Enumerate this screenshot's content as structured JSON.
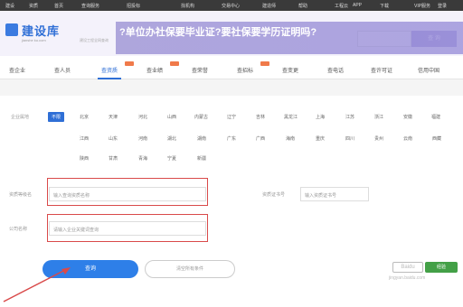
{
  "topbar": {
    "items": [
      "建设",
      "资质",
      "首页",
      "查询服务",
      "招投标",
      "找机构",
      "交易中心",
      "建造师",
      "帮助",
      "工程云",
      "APP",
      "下载",
      "VIP服务",
      "登录"
    ]
  },
  "header": {
    "logo_text": "建设库",
    "logo_sub": "jianshe ku.com",
    "note": "建设工程全网查询",
    "overlay_title": "?单位办社保要毕业证?要社保要学历证明吗?",
    "search_button": "查 询"
  },
  "nav": {
    "items": [
      "查企业",
      "查人员",
      "查资质",
      "查业绩",
      "查荣誉",
      "查招标",
      "查变更",
      "查电话",
      "查许可证",
      "信用中国"
    ],
    "active_index": 2
  },
  "filter": {
    "region_label": "企业属地",
    "provinces_row1": [
      "不限",
      "北京",
      "天津",
      "河北",
      "山西",
      "内蒙古",
      "辽宁",
      "吉林",
      "黑龙江",
      "上海",
      "江苏",
      "浙江",
      "安徽",
      "福建"
    ],
    "provinces_row2": [
      "江西",
      "山东",
      "河南",
      "湖北",
      "湖南",
      "广东",
      "广西",
      "海南",
      "重庆",
      "四川",
      "贵州",
      "云南",
      "西藏"
    ],
    "provinces_row3": [
      "陕西",
      "甘肃",
      "青海",
      "宁夏",
      "新疆"
    ],
    "name_label": "资质等级名",
    "name_placeholder": "输入查询资质名称",
    "cert_label": "资质证书号",
    "cert_placeholder": "输入资质证书号",
    "company_label": "公司名称",
    "company_placeholder": "请输入企业关键词查询"
  },
  "actions": {
    "search_label": "查询",
    "clear_label": "清空所有条件"
  },
  "watermark": {
    "badge": "Baidu",
    "green": "经验",
    "url": "jingyan.baidu.com"
  },
  "colors": {
    "accent": "#2f6fd6",
    "highlight_border": "#d94a4a",
    "overlay": "#9a8fd8"
  }
}
